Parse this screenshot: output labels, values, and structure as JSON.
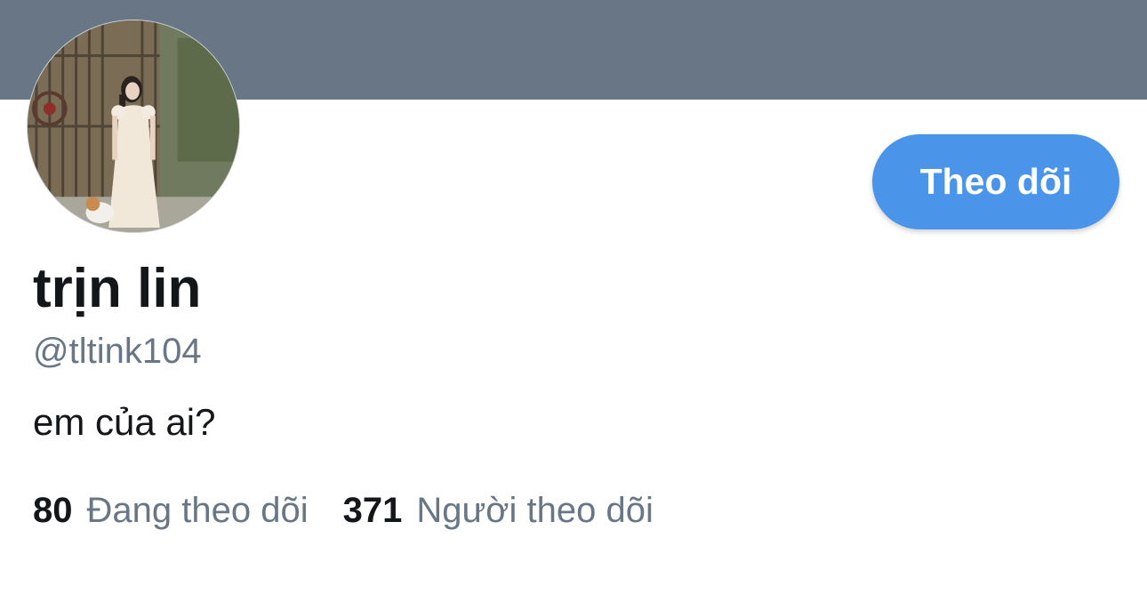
{
  "banner": {
    "color": "#687685"
  },
  "avatar": {
    "icon": "profile-photo"
  },
  "follow_button": {
    "label": "Theo dõi",
    "color": "#4a94ea"
  },
  "profile": {
    "display_name": "trịn lin",
    "handle": "@tltink104",
    "bio": "em của ai?"
  },
  "stats": {
    "following": {
      "count": "80",
      "label": "Đang theo dõi"
    },
    "followers": {
      "count": "371",
      "label": "Người theo dõi"
    }
  }
}
